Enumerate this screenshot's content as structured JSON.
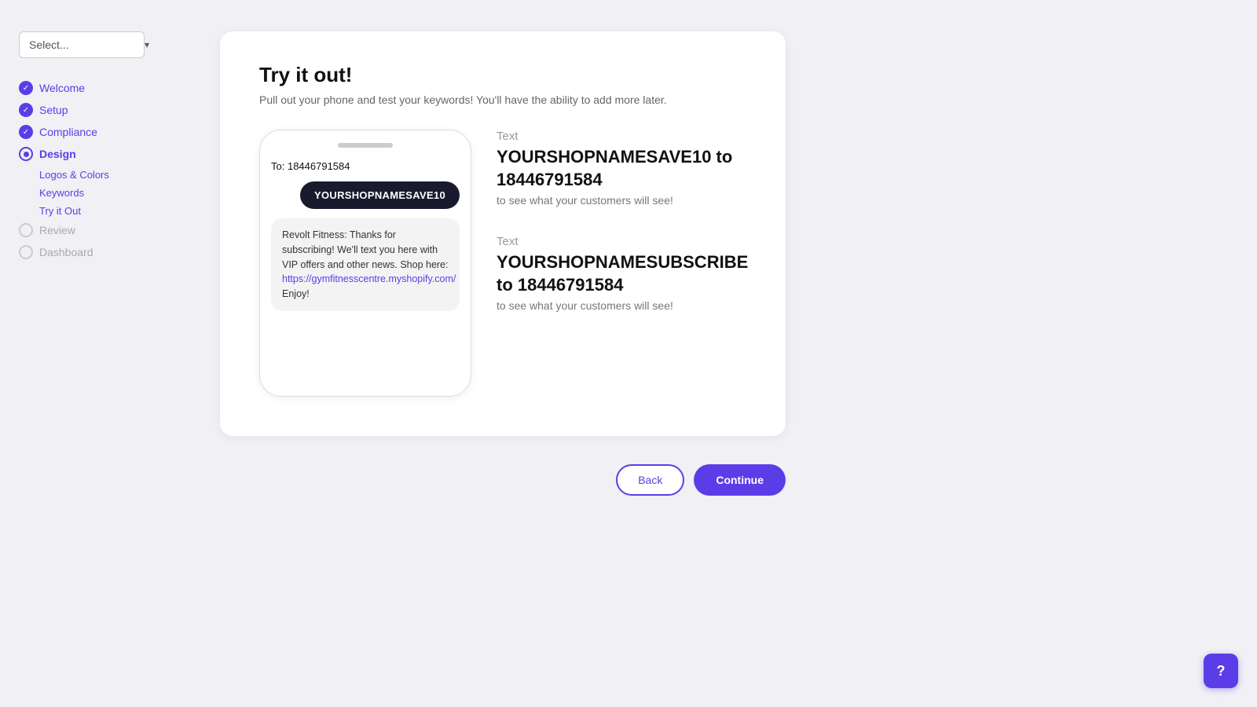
{
  "sidebar": {
    "select_placeholder": "Select...",
    "nav_items": [
      {
        "id": "welcome",
        "label": "Welcome",
        "state": "completed"
      },
      {
        "id": "setup",
        "label": "Setup",
        "state": "completed"
      },
      {
        "id": "compliance",
        "label": "Compliance",
        "state": "completed"
      },
      {
        "id": "design",
        "label": "Design",
        "state": "active",
        "subitems": [
          {
            "id": "logos-colors",
            "label": "Logos & Colors",
            "state": "normal"
          },
          {
            "id": "keywords",
            "label": "Keywords",
            "state": "normal"
          },
          {
            "id": "try-it-out",
            "label": "Try it Out",
            "state": "active"
          }
        ]
      },
      {
        "id": "review",
        "label": "Review",
        "state": "inactive"
      },
      {
        "id": "dashboard",
        "label": "Dashboard",
        "state": "inactive"
      }
    ]
  },
  "page": {
    "title": "Try it out!",
    "subtitle": "Pull out your phone and test your keywords! You'll have the ability to add more later."
  },
  "phone": {
    "to_label": "To:",
    "phone_number": "18446791584",
    "keyword": "YOURSHOPNAMESAVE10",
    "message": "Revolt Fitness: Thanks for subscribing! We'll text you here with VIP offers and other news. Shop here: https://gymfitnesscentre.myshopify.com/ Enjoy!"
  },
  "instructions": [
    {
      "id": "save10",
      "prefix": "Text",
      "keyword": "YOURSHOPNAMESAVE10 to 18446791584",
      "suffix": "to see what your customers will see!"
    },
    {
      "id": "subscribe",
      "prefix": "Text",
      "keyword": "YOURSHOPNAMESUBSCRIBE to 18446791584",
      "suffix": "to see what your customers will see!"
    }
  ],
  "buttons": {
    "back_label": "Back",
    "continue_label": "Continue"
  },
  "help": {
    "icon": "?"
  }
}
